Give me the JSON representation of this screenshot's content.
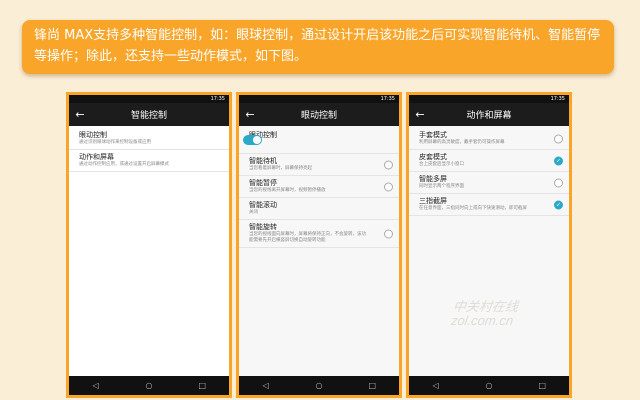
{
  "banner": {
    "text": "锋尚 MAX支持多种智能控制，如：眼球控制，通过设计开启该功能之后可实现智能待机、智能暂停等操作；除此，还支持一些动作模式，如下图。"
  },
  "status_time": "17:35",
  "nav_icons": {
    "back": "◁",
    "home": "○",
    "recent": "□"
  },
  "colors": {
    "accent": "#f8a52a",
    "toggle": "#2aa9c9"
  },
  "screens": [
    {
      "title": "智能控制",
      "items": [
        {
          "title": "眼动控制",
          "sub": "通过识别眼球动作来控制设备或应用"
        },
        {
          "title": "动作和屏幕",
          "sub": "通过动作控制应用，或通过设置开启屏幕模式"
        }
      ]
    },
    {
      "title": "眼动控制",
      "items": [
        {
          "title": "眼动控制",
          "sub": "",
          "control": "toggle-on"
        },
        {
          "title": "智能待机",
          "sub": "当您看着屏幕时，屏幕保持亮起",
          "control": "radio-off"
        },
        {
          "title": "智能暂停",
          "sub": "当您的视线离开屏幕时，视频暂停播放",
          "control": "radio-off"
        },
        {
          "title": "智能滚动",
          "sub": "关闭",
          "control": "none"
        },
        {
          "title": "智能旋转",
          "sub": "当您的视线面向屏幕时，屏幕将保持正向，不会旋转，该功能需要先开启横竖屏切换自动旋转功能",
          "control": "radio-off"
        }
      ]
    },
    {
      "title": "动作和屏幕",
      "items": [
        {
          "title": "手套模式",
          "sub": "利用屏幕的高灵敏度，戴手套仍可操作屏幕",
          "control": "radio-off"
        },
        {
          "title": "皮套模式",
          "sub": "合上皮套后显示小窗口",
          "control": "radio-on"
        },
        {
          "title": "智能多屏",
          "sub": "同时显示两个程序界面",
          "control": "radio-off"
        },
        {
          "title": "三指截屏",
          "sub": "在任意界面，三指同时向上或向下快速滑动，即可截屏",
          "control": "radio-on"
        }
      ]
    }
  ],
  "watermark": {
    "line1": "中关村在线",
    "line2": "zol.com.cn"
  }
}
